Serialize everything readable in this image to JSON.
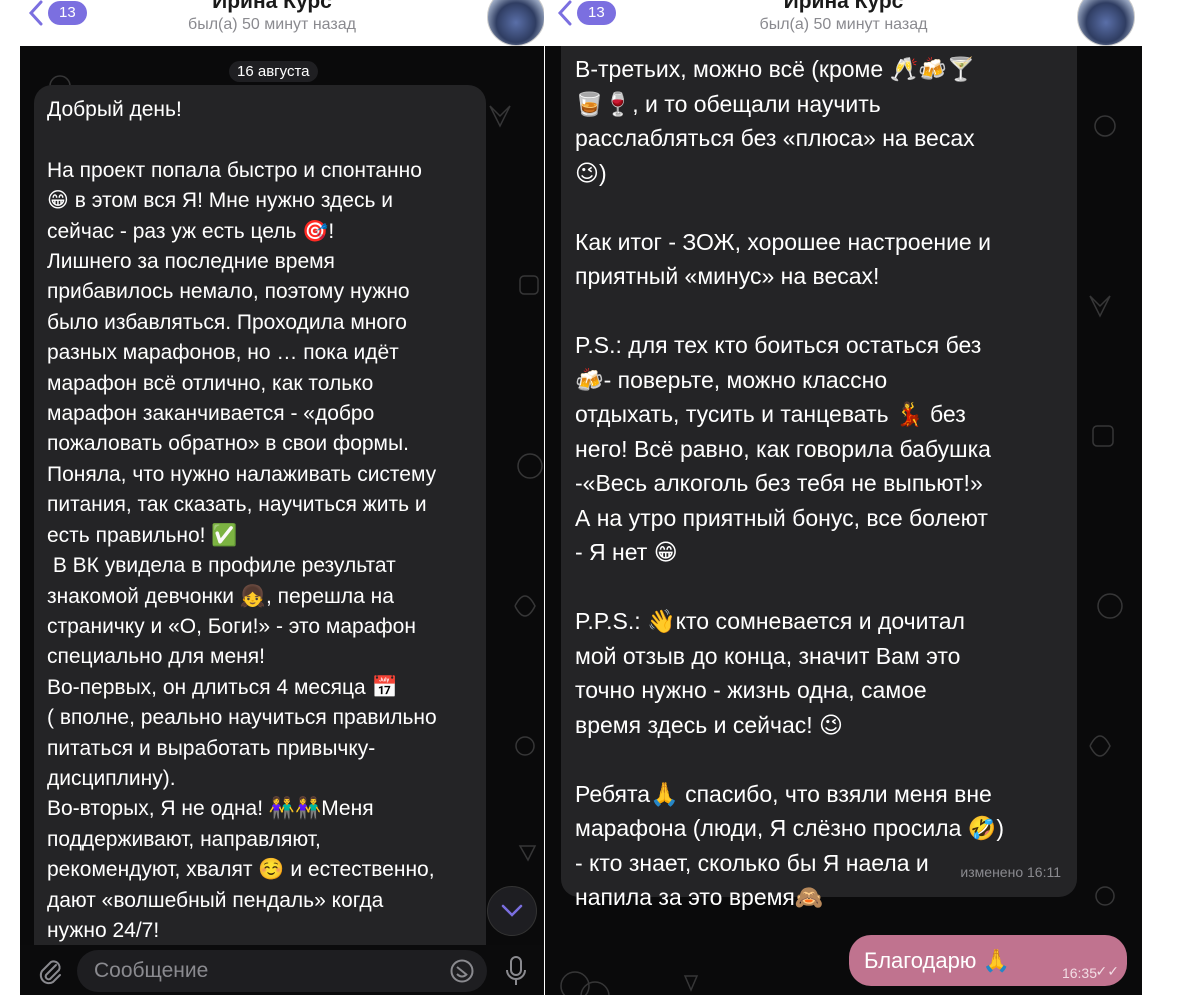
{
  "header": {
    "name": "Ирина Курс",
    "status": "был(а) 50 минут назад",
    "badge": "13"
  },
  "left": {
    "date": "16 августа",
    "message_lines": [
      "Добрый день!",
      "",
      "На проект попала быстро и спонтанно",
      "😁 в этом вся Я! Мне нужно здесь и",
      "сейчас - раз уж есть цель 🎯!",
      "Лишнего за последние время",
      "прибавилось немало, поэтому нужно",
      "было избавляться. Проходила много",
      "разных марафонов, но … пока идёт",
      "марафон всё отлично, как только",
      "марафон заканчивается - «добро",
      "пожаловать обратно» в свои формы.",
      "Поняла, что нужно налаживать систему",
      "питания, так сказать, научиться жить и",
      "есть правильно! ✅",
      " В ВК увидела в профиле результат",
      "знакомой девчонки 👧, перешла на",
      "страничку и «О, Боги!» - это марафон",
      "специально для меня!",
      "Во-первых, он длиться 4 месяца 📅",
      "( вполне, реально научиться правильно",
      "питаться и выработать привычку-",
      "дисциплину).",
      "Во-вторых, Я не одна! 👫👫Меня",
      "поддерживают, направляют,",
      "рекомендуют, хвалят ☺️ и естественно,",
      "дают «волшебный пендаль» когда",
      "нужно 24/7!"
    ],
    "input_placeholder": "Сообщение"
  },
  "right": {
    "message_lines": [
      "В-третьих, можно всё (кроме 🥂🍻🍸",
      "🥃🍷, и то обещали научить",
      "расслабляться без «плюса» на весах",
      "😉)",
      "",
      "Как итог - ЗОЖ, хорошее настроение и",
      "приятный «минус» на весах!",
      "",
      "P.S.: для тех кто боиться остаться без",
      "🍻- поверьте, можно классно",
      "отдыхать, тусить и танцевать 💃 без",
      "него! Всё равно, как говорила бабушка",
      "-«Весь алкоголь без тебя не выпьют!»",
      "А на утро приятный бонус, все болеют",
      "- Я нет 😁",
      "",
      "P.P.S.: 👋кто сомневается и дочитал",
      "мой отзыв до конца, значит Вам это",
      "точно нужно - жизнь одна, самое",
      "время здесь и сейчас! 😉",
      "",
      "Ребята🙏 спасибо, что взяли меня вне",
      "марафона (люди, Я слёзно просила 🤣)",
      "- кто знает, сколько бы Я наела и",
      "напила за это время🙈"
    ],
    "edited_label": "изменено 16:11",
    "outgoing": {
      "text": "Благодарю 🙏",
      "time": "16:35"
    }
  }
}
